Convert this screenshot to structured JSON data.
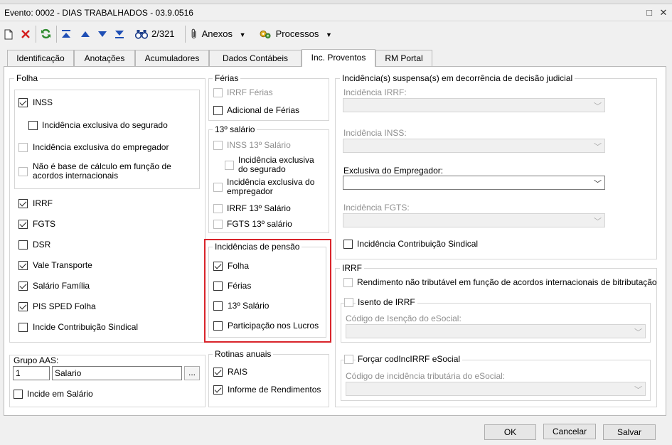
{
  "window": {
    "title": "Evento: 0002 - DIAS TRABALHADOS - 03.9.0516",
    "restore_glyph": "□",
    "close_glyph": "✕"
  },
  "toolbar": {
    "record_position": "2/321",
    "attachments_label": "Anexos",
    "processes_label": "Processos"
  },
  "tabs": [
    "Identificação",
    "Anotações",
    "Acumuladores",
    "Dados Contábeis",
    "Inc. Proventos",
    "RM Portal"
  ],
  "folha": {
    "title": "Folha",
    "inss": "INSS",
    "inc_excl_segurado": "Incidência exclusiva do segurado",
    "inc_excl_empregador": "Incidência exclusiva do empregador",
    "nao_base": "Não é base de cálculo em função de acordos internacionais",
    "irrf": "IRRF",
    "fgts": "FGTS",
    "dsr": "DSR",
    "vale": "Vale Transporte",
    "salario_familia": "Salário Família",
    "pis": "PIS SPED Folha",
    "sindical": "Incide Contribuição Sindical"
  },
  "grupo": {
    "title": "Grupo AAS:",
    "code": "1",
    "name": "Salario",
    "browse": "...",
    "incide": "Incide em Salário"
  },
  "ferias": {
    "title": "Férias",
    "irrf": "IRRF Férias",
    "adicional": "Adicional de Férias"
  },
  "decimo": {
    "title": "13º salário",
    "inss": "INSS 13º Salário",
    "excl_segurado": "Incidência exclusiva do segurado",
    "excl_empregador": "Incidência exclusiva do empregador",
    "irrf": "IRRF 13º Salário",
    "fgts": "FGTS 13º salário"
  },
  "pensao": {
    "title": "Incidências de pensão",
    "folha": "Folha",
    "ferias": "Férias",
    "decimo": "13º Salário",
    "lucros": "Participação nos Lucros"
  },
  "rotinas": {
    "title": "Rotinas anuais",
    "rais": "RAIS",
    "informe": "Informe de Rendimentos"
  },
  "suspensa": {
    "title": "Incidência(s) suspensa(s) em decorrência de decisão judicial",
    "irrf": "Incidência IRRF:",
    "inss": "Incidência INSS:",
    "empregador": "Exclusiva do Empregador:",
    "fgts": "Incidência FGTS:",
    "sindical": "Incidência Contribuição Sindical"
  },
  "irrf_group": {
    "title": "IRRF",
    "rendimento": "Rendimento não tributável em função de acordos internacionais de bitributação",
    "isento": "Isento de IRRF",
    "codigo_isencao": "Código de Isenção do eSocial:",
    "forcar": "Forçar codIncIRRF eSocial",
    "codigo_incidencia": "Código de incidência tributária do eSocial:"
  },
  "buttons": {
    "ok": "OK",
    "cancel": "Cancelar",
    "save": "Salvar"
  },
  "colors": {
    "highlight_border": "#d9242b",
    "refresh_green": "#2e8b2e",
    "delete_red": "#d42020",
    "nav_blue": "#1f4fb5"
  }
}
